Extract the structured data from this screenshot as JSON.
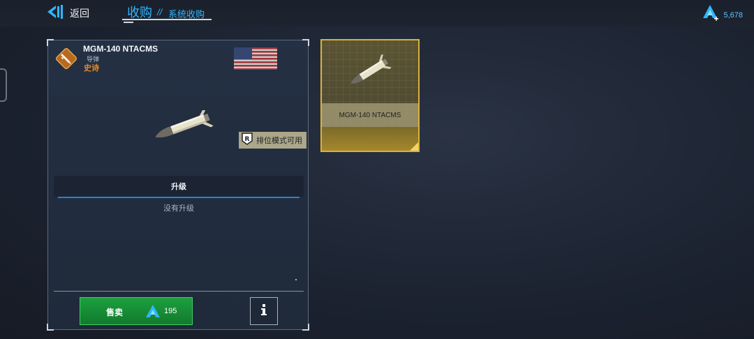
{
  "topbar": {
    "back_label": "返回",
    "tab_main": "收购",
    "tab_separator": "//",
    "tab_sub": "系统收购",
    "currency_value": "5,678"
  },
  "card": {
    "name": "MGM-140 NTACMS",
    "type": "导弹",
    "rarity": "史诗",
    "ranked_label": "排位模式可用",
    "upgrade_title": "升级",
    "upgrade_status": "没有升级",
    "sell_label": "售卖",
    "sell_price": "195"
  },
  "tile": {
    "name": "MGM-140 NTACMS"
  },
  "colors": {
    "accent": "#2fb6ff",
    "rarity": "#e08a2c",
    "sell_green": "#1ca03f",
    "tile_gold": "#d9b23a"
  }
}
